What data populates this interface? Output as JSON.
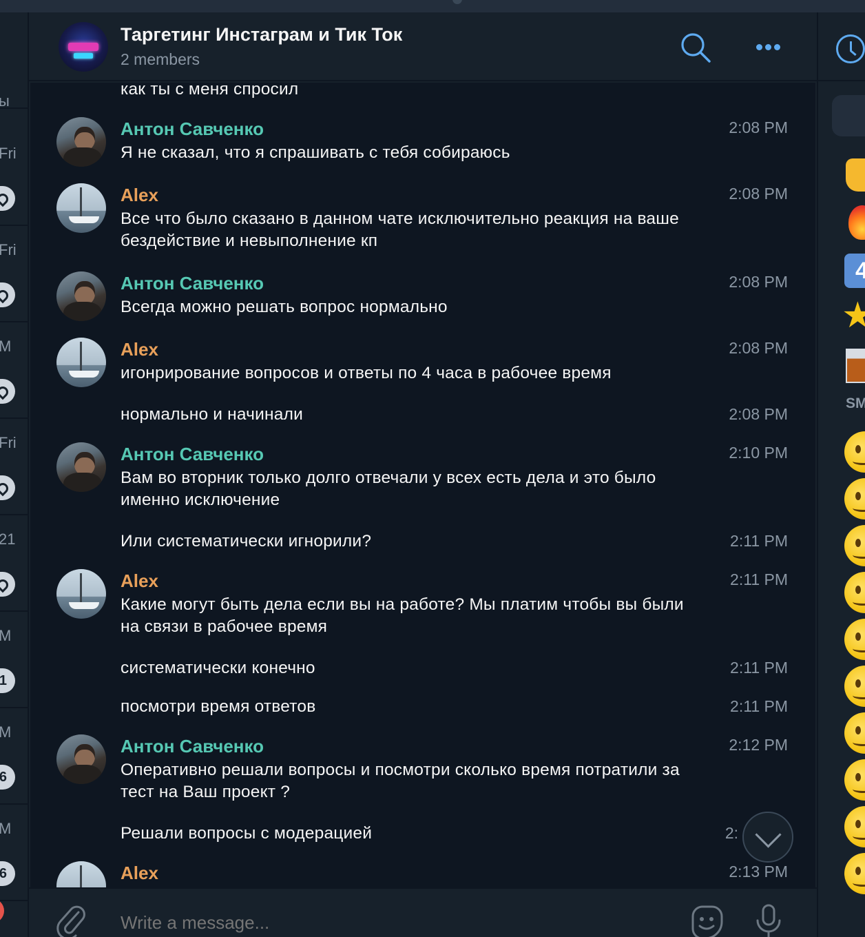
{
  "header": {
    "title": "Таргетинг Инстаграм и Тик Ток",
    "subtitle": "2 members"
  },
  "sidebar_fragments": [
    {
      "label": "ы",
      "kind": "text"
    },
    {
      "label": "Fri",
      "kind": "text"
    },
    {
      "label": "Fri",
      "kind": "text"
    },
    {
      "label": "M",
      "kind": "text"
    },
    {
      "label": "Fri",
      "kind": "text"
    },
    {
      "label": "21",
      "kind": "text"
    },
    {
      "label": "M",
      "kind": "text"
    },
    {
      "label": "1",
      "kind": "badge"
    },
    {
      "label": "M",
      "kind": "text"
    },
    {
      "label": "6",
      "kind": "badge"
    },
    {
      "label": "M",
      "kind": "text"
    },
    {
      "label": "6",
      "kind": "badge"
    }
  ],
  "messages": [
    {
      "author": "",
      "text": "как ты с меня спросил",
      "time": ""
    },
    {
      "author": "Антон Савченко",
      "text": "Я не сказал, что я спрашивать с тебя собираюсь",
      "time": "2:08 PM"
    },
    {
      "author": "Alex",
      "text": "Все что было сказано в данном чате исключительно реакция на ваше бездействие и невыполнение кп",
      "time": "2:08 PM"
    },
    {
      "author": "Антон Савченко",
      "text": "Всегда можно решать вопрос нормально",
      "time": "2:08 PM"
    },
    {
      "author": "Alex",
      "text": "игонрирование вопросов и ответы по 4 часа в рабочее время",
      "time": "2:08 PM"
    },
    {
      "author": "",
      "text": "нормально и начинали",
      "time": "2:08 PM"
    },
    {
      "author": "Антон Савченко",
      "text": "Вам во вторник только долго отвечали у всех есть дела и это было именно исключение",
      "time": "2:10 PM"
    },
    {
      "author": "",
      "text": "Или систематически игнорили?",
      "time": "2:11 PM"
    },
    {
      "author": "Alex",
      "text": "Какие могут быть дела если вы на работе? Мы платим чтобы вы были на связи в рабочее время",
      "time": "2:11 PM"
    },
    {
      "author": "",
      "text": "систематически конечно",
      "time": "2:11 PM"
    },
    {
      "author": "",
      "text": "посмотри время ответов",
      "time": "2:11 PM"
    },
    {
      "author": "Антон Савченко",
      "text": "Оперативно решали вопросы и посмотри сколько время потратили за тест на Ваш проект ?",
      "time": "2:12 PM"
    },
    {
      "author": "",
      "text": "Решали вопросы с модерацией",
      "time": "2:"
    },
    {
      "author": "Alex",
      "text": "",
      "time": "2:13 PM"
    }
  ],
  "composer": {
    "placeholder": "Write a message..."
  },
  "emoji_panel": {
    "section_label": "SM",
    "emoji": [
      "😀",
      "🥲",
      "😍",
      "😝",
      "🤩",
      "🙁",
      "😭",
      "🥶",
      "🫢",
      "🫣"
    ]
  },
  "colors": {
    "anton": "#56c8b3",
    "alex": "#e8a05a",
    "accent": "#5eaaf0"
  }
}
